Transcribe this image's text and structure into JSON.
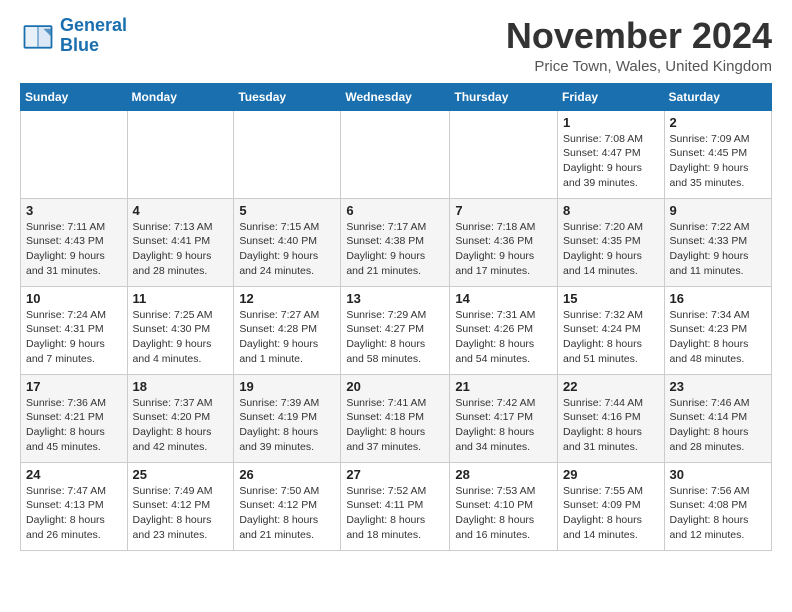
{
  "logo": {
    "line1": "General",
    "line2": "Blue"
  },
  "title": "November 2024",
  "location": "Price Town, Wales, United Kingdom",
  "days_of_week": [
    "Sunday",
    "Monday",
    "Tuesday",
    "Wednesday",
    "Thursday",
    "Friday",
    "Saturday"
  ],
  "weeks": [
    [
      {
        "day": "",
        "info": ""
      },
      {
        "day": "",
        "info": ""
      },
      {
        "day": "",
        "info": ""
      },
      {
        "day": "",
        "info": ""
      },
      {
        "day": "",
        "info": ""
      },
      {
        "day": "1",
        "info": "Sunrise: 7:08 AM\nSunset: 4:47 PM\nDaylight: 9 hours\nand 39 minutes."
      },
      {
        "day": "2",
        "info": "Sunrise: 7:09 AM\nSunset: 4:45 PM\nDaylight: 9 hours\nand 35 minutes."
      }
    ],
    [
      {
        "day": "3",
        "info": "Sunrise: 7:11 AM\nSunset: 4:43 PM\nDaylight: 9 hours\nand 31 minutes."
      },
      {
        "day": "4",
        "info": "Sunrise: 7:13 AM\nSunset: 4:41 PM\nDaylight: 9 hours\nand 28 minutes."
      },
      {
        "day": "5",
        "info": "Sunrise: 7:15 AM\nSunset: 4:40 PM\nDaylight: 9 hours\nand 24 minutes."
      },
      {
        "day": "6",
        "info": "Sunrise: 7:17 AM\nSunset: 4:38 PM\nDaylight: 9 hours\nand 21 minutes."
      },
      {
        "day": "7",
        "info": "Sunrise: 7:18 AM\nSunset: 4:36 PM\nDaylight: 9 hours\nand 17 minutes."
      },
      {
        "day": "8",
        "info": "Sunrise: 7:20 AM\nSunset: 4:35 PM\nDaylight: 9 hours\nand 14 minutes."
      },
      {
        "day": "9",
        "info": "Sunrise: 7:22 AM\nSunset: 4:33 PM\nDaylight: 9 hours\nand 11 minutes."
      }
    ],
    [
      {
        "day": "10",
        "info": "Sunrise: 7:24 AM\nSunset: 4:31 PM\nDaylight: 9 hours\nand 7 minutes."
      },
      {
        "day": "11",
        "info": "Sunrise: 7:25 AM\nSunset: 4:30 PM\nDaylight: 9 hours\nand 4 minutes."
      },
      {
        "day": "12",
        "info": "Sunrise: 7:27 AM\nSunset: 4:28 PM\nDaylight: 9 hours\nand 1 minute."
      },
      {
        "day": "13",
        "info": "Sunrise: 7:29 AM\nSunset: 4:27 PM\nDaylight: 8 hours\nand 58 minutes."
      },
      {
        "day": "14",
        "info": "Sunrise: 7:31 AM\nSunset: 4:26 PM\nDaylight: 8 hours\nand 54 minutes."
      },
      {
        "day": "15",
        "info": "Sunrise: 7:32 AM\nSunset: 4:24 PM\nDaylight: 8 hours\nand 51 minutes."
      },
      {
        "day": "16",
        "info": "Sunrise: 7:34 AM\nSunset: 4:23 PM\nDaylight: 8 hours\nand 48 minutes."
      }
    ],
    [
      {
        "day": "17",
        "info": "Sunrise: 7:36 AM\nSunset: 4:21 PM\nDaylight: 8 hours\nand 45 minutes."
      },
      {
        "day": "18",
        "info": "Sunrise: 7:37 AM\nSunset: 4:20 PM\nDaylight: 8 hours\nand 42 minutes."
      },
      {
        "day": "19",
        "info": "Sunrise: 7:39 AM\nSunset: 4:19 PM\nDaylight: 8 hours\nand 39 minutes."
      },
      {
        "day": "20",
        "info": "Sunrise: 7:41 AM\nSunset: 4:18 PM\nDaylight: 8 hours\nand 37 minutes."
      },
      {
        "day": "21",
        "info": "Sunrise: 7:42 AM\nSunset: 4:17 PM\nDaylight: 8 hours\nand 34 minutes."
      },
      {
        "day": "22",
        "info": "Sunrise: 7:44 AM\nSunset: 4:16 PM\nDaylight: 8 hours\nand 31 minutes."
      },
      {
        "day": "23",
        "info": "Sunrise: 7:46 AM\nSunset: 4:14 PM\nDaylight: 8 hours\nand 28 minutes."
      }
    ],
    [
      {
        "day": "24",
        "info": "Sunrise: 7:47 AM\nSunset: 4:13 PM\nDaylight: 8 hours\nand 26 minutes."
      },
      {
        "day": "25",
        "info": "Sunrise: 7:49 AM\nSunset: 4:12 PM\nDaylight: 8 hours\nand 23 minutes."
      },
      {
        "day": "26",
        "info": "Sunrise: 7:50 AM\nSunset: 4:12 PM\nDaylight: 8 hours\nand 21 minutes."
      },
      {
        "day": "27",
        "info": "Sunrise: 7:52 AM\nSunset: 4:11 PM\nDaylight: 8 hours\nand 18 minutes."
      },
      {
        "day": "28",
        "info": "Sunrise: 7:53 AM\nSunset: 4:10 PM\nDaylight: 8 hours\nand 16 minutes."
      },
      {
        "day": "29",
        "info": "Sunrise: 7:55 AM\nSunset: 4:09 PM\nDaylight: 8 hours\nand 14 minutes."
      },
      {
        "day": "30",
        "info": "Sunrise: 7:56 AM\nSunset: 4:08 PM\nDaylight: 8 hours\nand 12 minutes."
      }
    ]
  ]
}
